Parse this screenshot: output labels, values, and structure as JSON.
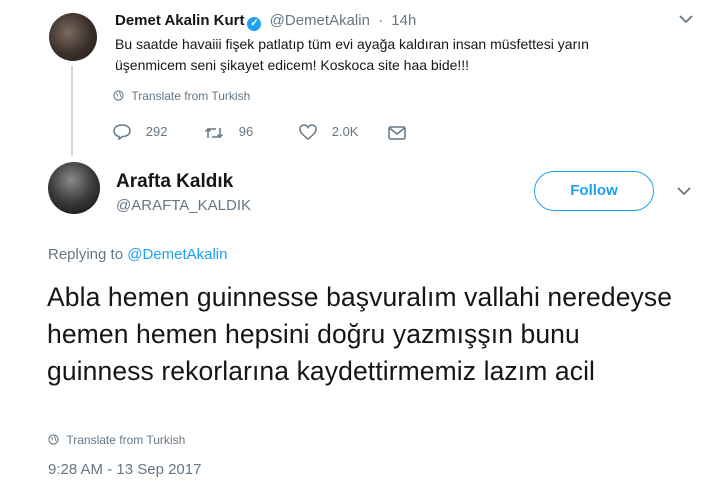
{
  "quoted_tweet": {
    "author_name": "Demet Akalin Kurt",
    "verified_mark": "✓",
    "handle": "@DemetAkalin",
    "separator": "·",
    "age": "14h",
    "text": "Bu saatde havaiii fişek patlatıp tüm evi ayağa kaldıran insan müsfettesi yarın üşenmicem seni şikayet edicem! Koskoca site haa bide!!!",
    "translate_label": "Translate from Turkish",
    "replies": "292",
    "retweets": "96",
    "likes": "2.0K"
  },
  "tweet": {
    "author_name": "Arafta Kaldık",
    "handle": "@ARAFTA_KALDIK",
    "follow_label": "Follow",
    "replying_prefix": "Replying to",
    "replying_to": "@DemetAkalin",
    "text": "Abla hemen guinnesse başvuralım vallahi neredeyse hemen hemen hepsini doğru yazmışşın bunu guinness rekorlarına kaydettirmemiz lazım acil",
    "translate_label": "Translate from Turkish",
    "timestamp": "9:28 AM - 13 Sep 2017"
  },
  "icons": {
    "reply": "reply-icon",
    "retweet": "retweet-icon",
    "like": "heart-icon",
    "message": "envelope-icon",
    "globe": "globe-icon",
    "chevron": "chevron-down-icon",
    "verified": "verified-badge-icon"
  },
  "colors": {
    "accent": "#1da1f2",
    "secondary_text": "#657786",
    "primary_text": "#14171a",
    "thread_line": "#ccd6dd"
  }
}
